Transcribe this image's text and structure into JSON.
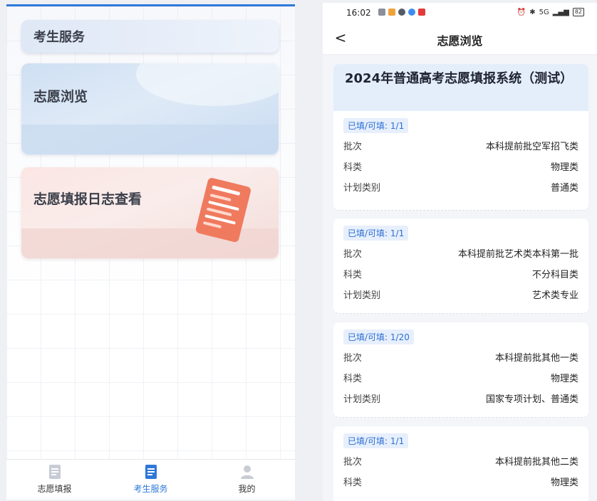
{
  "left": {
    "section_title": "考生服务",
    "cards": [
      {
        "title": "志愿浏览"
      },
      {
        "title": "志愿填报日志查看"
      }
    ],
    "nav": [
      {
        "label": "志愿填报"
      },
      {
        "label": "考生服务"
      },
      {
        "label": "我的"
      }
    ],
    "accent": "#2f78d8"
  },
  "right": {
    "status": {
      "time": "16:02",
      "network": "5G",
      "battery": "82"
    },
    "page_title": "志愿浏览",
    "back_label": "<",
    "system_title": "2024年普通高考志愿填报系统（测试）",
    "field_labels": {
      "batch": "批次",
      "subject": "科类",
      "plan": "计划类别"
    },
    "records": [
      {
        "badge": "已填/可填: 1/1",
        "batch": "本科提前批空军招飞类",
        "subject": "物理类",
        "plan": "普通类"
      },
      {
        "badge": "已填/可填: 1/1",
        "batch": "本科提前批艺术类本科第一批",
        "subject": "不分科目类",
        "plan": "艺术类专业"
      },
      {
        "badge": "已填/可填: 1/20",
        "batch": "本科提前批其他一类",
        "subject": "物理类",
        "plan": "国家专项计划、普通类"
      },
      {
        "badge": "已填/可填: 1/1",
        "batch": "本科提前批其他二类",
        "subject": "物理类"
      }
    ]
  }
}
